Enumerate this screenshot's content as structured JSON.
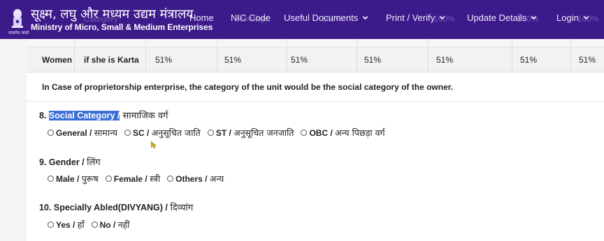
{
  "header": {
    "brand_hindi": "सूक्ष्म, लघु और मध्यम उद्यम मंत्रालय",
    "brand_english": "Ministry of Micro, Small & Medium Enterprises",
    "emblem_caption": "सत्यमेव जयते",
    "nav": [
      {
        "label": "Home",
        "dropdown": false
      },
      {
        "label": "NIC Code",
        "dropdown": false
      },
      {
        "label": "Useful Documents",
        "dropdown": true
      },
      {
        "label": "Print / Verify",
        "dropdown": true
      },
      {
        "label": "Update Details",
        "dropdown": true
      },
      {
        "label": "Login",
        "dropdown": true
      }
    ],
    "ghost_text": [
      "Category",
      "rcentage",
      "100%",
      "100%",
      "100%",
      "100%"
    ]
  },
  "table": {
    "row_label": "Women",
    "row_condition": "if she is Karta",
    "values": [
      "51%",
      "51%",
      "51%",
      "51%",
      "51%",
      "51%",
      "51%"
    ],
    "note": "In Case of proprietorship enterprise, the category of the unit would be the social category of the owner."
  },
  "questions": [
    {
      "number": "8.",
      "label_en": "Social Category /",
      "label_hi": " सामाजिक वर्ग",
      "highlighted": true,
      "options": [
        {
          "en": "General / ",
          "hi": "सामान्य"
        },
        {
          "en": "SC / ",
          "hi": "अनुसूचित जाति"
        },
        {
          "en": "ST / ",
          "hi": "अनुसूचित जनजाति"
        },
        {
          "en": "OBC / ",
          "hi": "अन्य पिछड़ा वर्ग"
        }
      ]
    },
    {
      "number": "9.",
      "label_en": "Gender / ",
      "label_hi": "लिंग",
      "highlighted": false,
      "options": [
        {
          "en": "Male / ",
          "hi": "पुरूष"
        },
        {
          "en": "Female / ",
          "hi": "स्त्री"
        },
        {
          "en": "Others / ",
          "hi": "अन्य"
        }
      ]
    },
    {
      "number": "10.",
      "label_en": "Specially Abled(DIVYANG) / ",
      "label_hi": "दिव्यांग",
      "highlighted": false,
      "options": [
        {
          "en": "Yes / ",
          "hi": "हाँ"
        },
        {
          "en": "No / ",
          "hi": "नहीं"
        }
      ]
    }
  ],
  "colors": {
    "navbar": "#3d1a8a",
    "selection": "#3a6ed8",
    "cursor": "#d4b400"
  },
  "icons": [
    "emblem-icon",
    "chevron-down-icon",
    "radio-icon",
    "cursor-icon"
  ]
}
